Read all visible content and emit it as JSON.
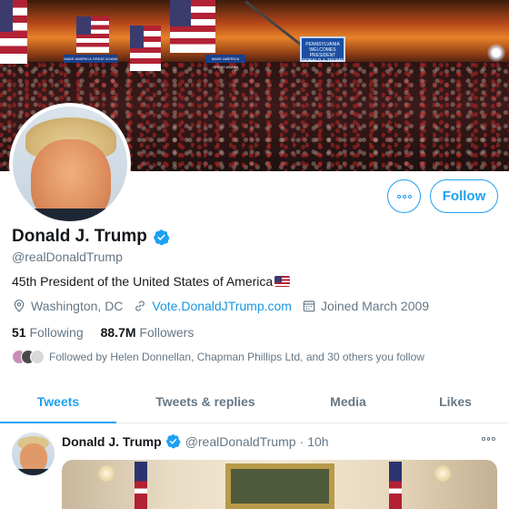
{
  "banner": {
    "screen_text": "PENNSYLVANIA WELCOMES PRESIDENT DONALD J. TRUMP",
    "sign_left": "MAKE AMERICA GREAT AGAIN!",
    "sign_right": "MAKE AMERICA GREAT AGAIN!"
  },
  "profile": {
    "name": "Donald J. Trump",
    "handle": "@realDonaldTrump",
    "bio": "45th President of the United States of America",
    "location": "Washington, DC",
    "website": "Vote.DonaldJTrump.com",
    "joined": "Joined March 2009",
    "following_count": "51",
    "following_label": "Following",
    "followers_count": "88.7M",
    "followers_label": "Followers",
    "followed_by": "Followed by Helen Donnellan, Chapman Phillips Ltd, and 30 others you follow"
  },
  "actions": {
    "follow_label": "Follow"
  },
  "tabs": [
    {
      "label": "Tweets",
      "active": true
    },
    {
      "label": "Tweets & replies",
      "active": false
    },
    {
      "label": "Media",
      "active": false
    },
    {
      "label": "Likes",
      "active": false
    }
  ],
  "tweet": {
    "name": "Donald J. Trump",
    "handle": "@realDonaldTrump",
    "separator": "·",
    "time": "10h"
  },
  "colors": {
    "accent": "#1da1f2",
    "secondary_text": "#657786",
    "primary_text": "#14171a"
  },
  "icons": [
    "more-icon",
    "verified-badge-icon",
    "location-icon",
    "link-icon",
    "calendar-icon",
    "us-flag-icon"
  ]
}
